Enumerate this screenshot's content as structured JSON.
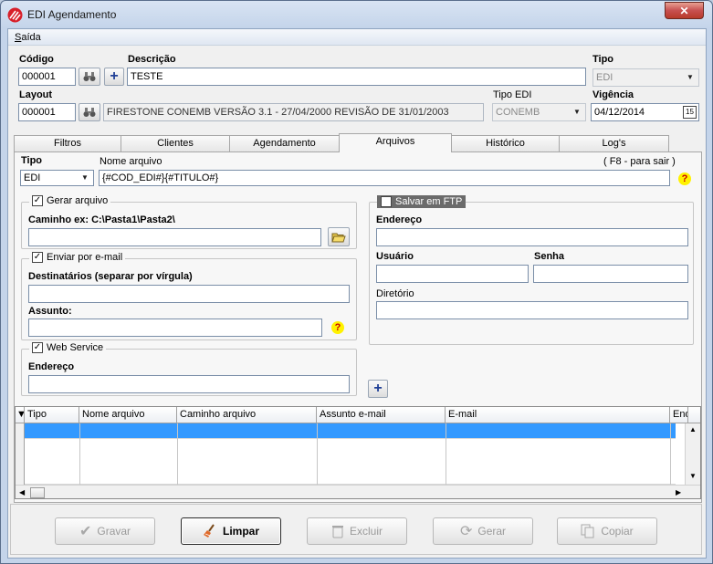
{
  "window": {
    "title": "EDI Agendamento",
    "close_label": "✕"
  },
  "menu": {
    "items": [
      {
        "label": "Saída"
      }
    ]
  },
  "header": {
    "codigo": {
      "label": "Código",
      "value": "000001"
    },
    "descricao": {
      "label": "Descrição",
      "value": "TESTE"
    },
    "tipo": {
      "label": "Tipo",
      "value": "EDI"
    },
    "layout": {
      "label": "Layout",
      "code": "000001",
      "value": "FIRESTONE CONEMB VERSÃO 3.1  - 27/04/2000 REVISÃO DE 31/01/2003"
    },
    "tipo_edi": {
      "label": "Tipo EDI",
      "value": "CONEMB"
    },
    "vigencia": {
      "label": "Vigência",
      "value": "04/12/2014",
      "calendar_label": "15"
    }
  },
  "tabs": [
    {
      "label": "Filtros"
    },
    {
      "label": "Clientes"
    },
    {
      "label": "Agendamento"
    },
    {
      "label": "Arquivos",
      "active": true
    },
    {
      "label": "Histórico"
    },
    {
      "label": "Log's"
    }
  ],
  "arquivos": {
    "tipo": {
      "label": "Tipo",
      "value": "EDI"
    },
    "nome_arquivo": {
      "label": "Nome arquivo",
      "value": "{#COD_EDI#}{#TITULO#}",
      "hint": "( F8 - para sair )"
    },
    "gerar_arquivo": {
      "label": "Gerar arquivo",
      "checked": true,
      "caminho_label": "Caminho ex: C:\\Pasta1\\Pasta2\\",
      "caminho_value": ""
    },
    "enviar_email": {
      "label": "Enviar por e-mail",
      "checked": true,
      "destinatarios_label": "Destinatários (separar por vírgula)",
      "assunto_label": "Assunto:",
      "destinatarios_value": "",
      "assunto_value": ""
    },
    "web_service": {
      "label": "Web Service",
      "checked": true,
      "endereco_label": "Endereço",
      "endereco_value": ""
    },
    "salvar_ftp": {
      "label": "Salvar em FTP",
      "checked": true,
      "endereco_label": "Endereço",
      "usuario_label": "Usuário",
      "senha_label": "Senha",
      "diretorio_label": "Diretório"
    },
    "help_symbol": "?",
    "add_symbol": "+"
  },
  "grid": {
    "columns": [
      "Tipo",
      "Nome arquivo",
      "Caminho arquivo",
      "Assunto e-mail",
      "E-mail",
      "End"
    ],
    "rows": [
      {
        "selected": true
      },
      {
        "selected": false
      },
      {
        "selected": false
      }
    ]
  },
  "footer": {
    "gravar": "Gravar",
    "limpar": "Limpar",
    "excluir": "Excluir",
    "gerar": "Gerar",
    "copiar": "Copiar"
  },
  "colors": {
    "selection": "#3399ff",
    "help_bg": "#fff200",
    "help_fg": "#c80000",
    "add_icon": "#1f3f96"
  }
}
